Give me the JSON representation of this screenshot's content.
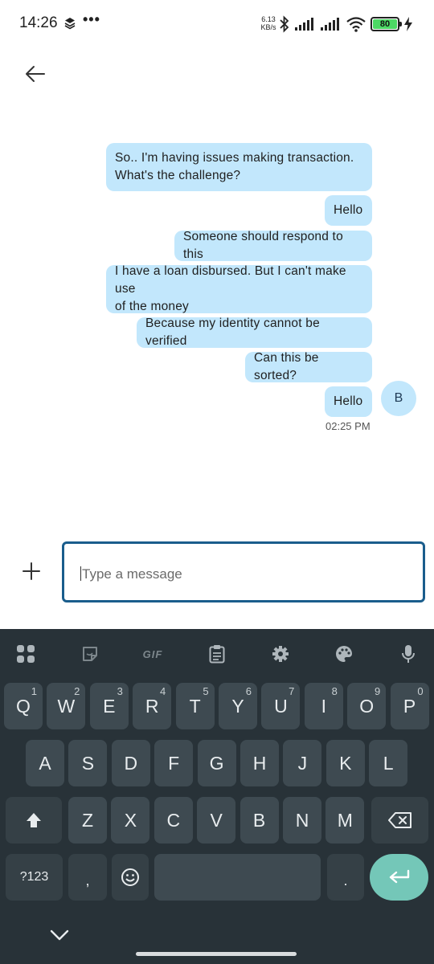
{
  "status_bar": {
    "time": "14:26",
    "dots": "•••",
    "speed_value": "6.13",
    "speed_unit": "KB/s",
    "battery": "80"
  },
  "messages": [
    {
      "line1": "So.. I'm having issues making transaction.",
      "line2": "What's the challenge?"
    },
    {
      "line1": "Hello",
      "line2": ""
    },
    {
      "line1": "Someone should respond to this",
      "line2": ""
    },
    {
      "line1": "I have a loan disbursed. But I can't make use",
      "line2": "of the money"
    },
    {
      "line1": "Because my identity cannot be verified",
      "line2": ""
    },
    {
      "line1": "Can this be sorted?",
      "line2": ""
    },
    {
      "line1": "Hello",
      "line2": ""
    }
  ],
  "timestamp": "02:25 PM",
  "avatar_initial": "B",
  "composer": {
    "placeholder": "Type a message"
  },
  "keyboard": {
    "toolbar": [
      "apps-icon",
      "sticker-icon",
      "gif-icon",
      "clipboard-icon",
      "settings-icon",
      "palette-icon",
      "mic-icon"
    ],
    "gif_label": "GIF",
    "row1": [
      {
        "k": "Q",
        "h": "1"
      },
      {
        "k": "W",
        "h": "2"
      },
      {
        "k": "E",
        "h": "3"
      },
      {
        "k": "R",
        "h": "4"
      },
      {
        "k": "T",
        "h": "5"
      },
      {
        "k": "Y",
        "h": "6"
      },
      {
        "k": "U",
        "h": "7"
      },
      {
        "k": "I",
        "h": "8"
      },
      {
        "k": "O",
        "h": "9"
      },
      {
        "k": "P",
        "h": "0"
      }
    ],
    "row2": [
      "A",
      "S",
      "D",
      "F",
      "G",
      "H",
      "J",
      "K",
      "L"
    ],
    "row3": [
      "Z",
      "X",
      "C",
      "V",
      "B",
      "N",
      "M"
    ],
    "symbols_label": "?123",
    "comma": ",",
    "period": "."
  },
  "colors": {
    "bubble": "#c2e7fc",
    "input_border": "#1a5d8c",
    "keyboard_bg": "#283238",
    "key_bg": "#3e4a51",
    "enter_key": "#74c7b8"
  }
}
